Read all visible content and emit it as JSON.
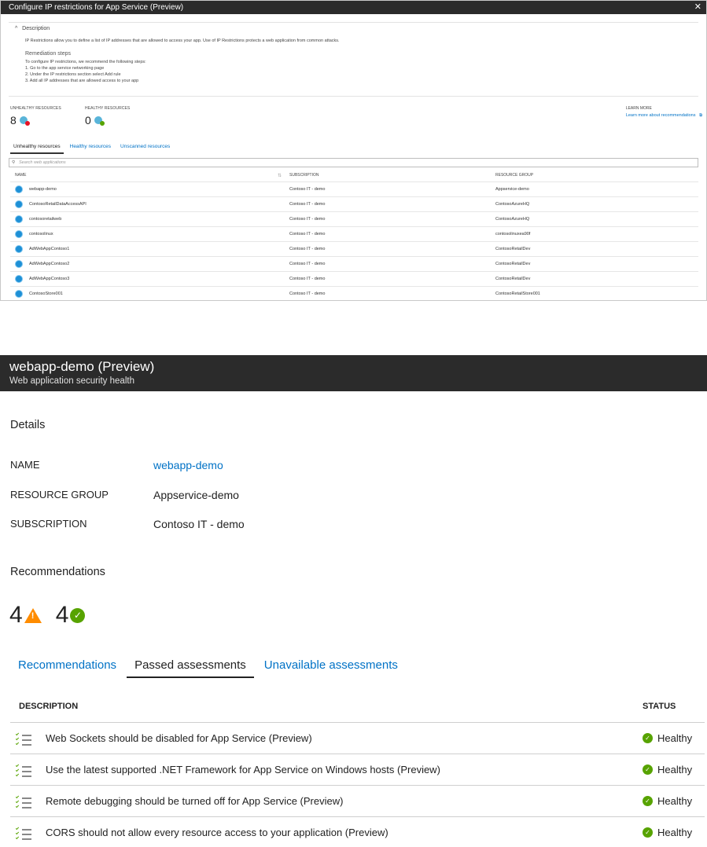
{
  "panel1": {
    "title": "Configure IP restrictions for App Service (Preview)",
    "close_glyph": "✕",
    "description_header": "Description",
    "description_text": "IP Restrictions allow you to define a list of IP addresses that are allowed to access your app. Use of IP Restrictions protects a web application from common attacks.",
    "remediation_header": "Remediation steps",
    "remediation_intro": "To configure IP restrictions, we recommend the following steps:",
    "steps": [
      "1. Go to the app service networking page",
      "2. Under the IP restrictions section select Add rule",
      "3. Add all IP addresses that are allowed access to your app"
    ],
    "unhealthy_label": "UNHEALTHY RESOURCES",
    "unhealthy_count": "8",
    "healthy_label": "HEALTHY RESOURCES",
    "healthy_count": "0",
    "learn_more_label": "LEARN MORE",
    "learn_more_link": "Learn more about recommendations",
    "tabs": [
      "Unhealthy resources",
      "Healthy resources",
      "Unscanned resources"
    ],
    "search_placeholder": "Search web applications",
    "columns": {
      "name": "NAME",
      "subscription": "SUBSCRIPTION",
      "resource_group": "RESOURCE GROUP"
    },
    "rows": [
      {
        "name": "webapp-demo",
        "subscription": "Contoso IT - demo",
        "rg": "Appservice-demo"
      },
      {
        "name": "ContosoRetailDataAccessAPI",
        "subscription": "Contoso IT - demo",
        "rg": "ContosoAzureHQ"
      },
      {
        "name": "contosoretailweb",
        "subscription": "Contoso IT - demo",
        "rg": "ContosoAzureHQ"
      },
      {
        "name": "contosolinux",
        "subscription": "Contoso IT - demo",
        "rg": "contosolinuxea90f"
      },
      {
        "name": "AdWebAppContoso1",
        "subscription": "Contoso IT - demo",
        "rg": "ContosoRetailDev"
      },
      {
        "name": "AdWebAppContoso2",
        "subscription": "Contoso IT - demo",
        "rg": "ContosoRetailDev"
      },
      {
        "name": "AdWebAppContoso3",
        "subscription": "Contoso IT - demo",
        "rg": "ContosoRetailDev"
      },
      {
        "name": "ContosoStore001",
        "subscription": "Contoso IT - demo",
        "rg": "ContosoRetailStore001"
      }
    ]
  },
  "panel2": {
    "title": "webapp-demo (Preview)",
    "subtitle": "Web application security health",
    "details_header": "Details",
    "name_label": "NAME",
    "name_value": "webapp-demo",
    "rg_label": "RESOURCE GROUP",
    "rg_value": "Appservice-demo",
    "sub_label": "SUBSCRIPTION",
    "sub_value": "Contoso IT - demo",
    "recommendations_header": "Recommendations",
    "warn_count": "4",
    "ok_count": "4",
    "tabs": [
      "Recommendations",
      "Passed assessments",
      "Unavailable assessments"
    ],
    "col_description": "DESCRIPTION",
    "col_status": "STATUS",
    "rows": [
      {
        "description": "Web Sockets should be disabled for App Service (Preview)",
        "status": "Healthy"
      },
      {
        "description": "Use the latest supported .NET Framework for App Service on Windows hosts (Preview)",
        "status": "Healthy"
      },
      {
        "description": "Remote debugging should be turned off for App Service (Preview)",
        "status": "Healthy"
      },
      {
        "description": "CORS should not allow every resource access to your application (Preview)",
        "status": "Healthy"
      }
    ]
  },
  "colors": {
    "link": "#0072c6",
    "healthy": "#57a300",
    "warning": "#ff8c00",
    "header_bg": "#2b2b2b"
  },
  "icons": {
    "warning": "warning-triangle-icon",
    "ok": "check-circle-icon",
    "app": "web-app-globe-icon",
    "list": "checklist-icon",
    "search": "search-icon"
  }
}
